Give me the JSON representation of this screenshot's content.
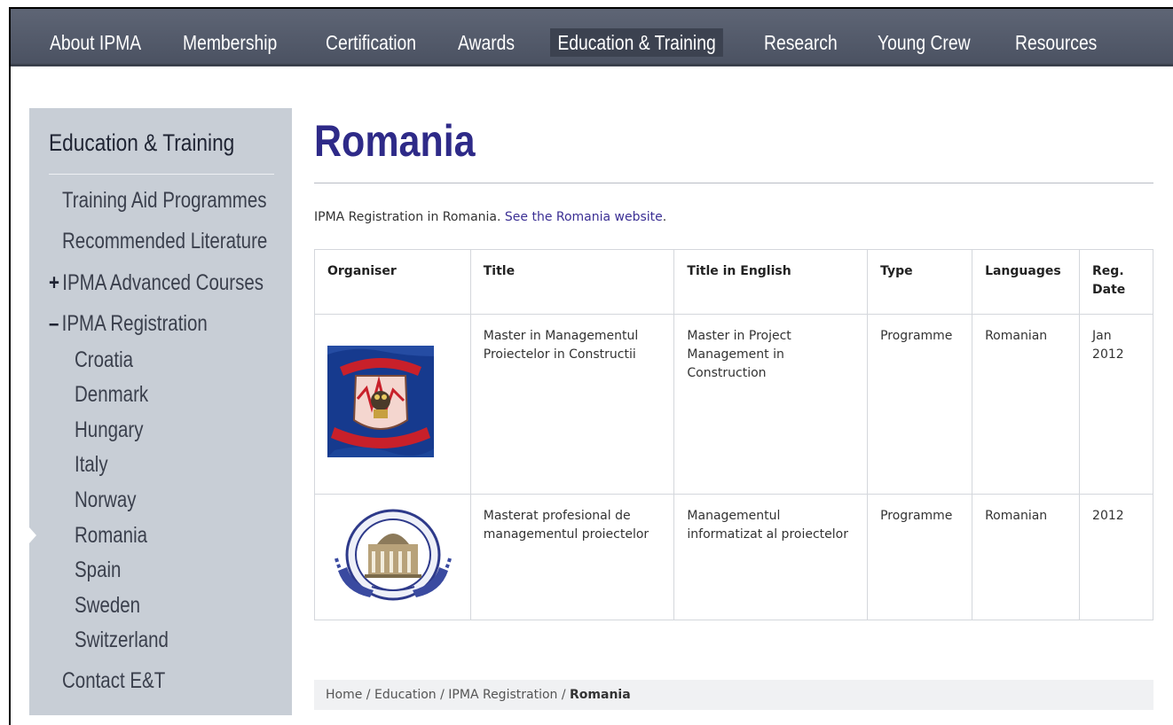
{
  "topnav": {
    "items": [
      "About IPMA",
      "Membership",
      "Certification",
      "Awards",
      "Education & Training",
      "Research",
      "Young Crew",
      "Resources"
    ],
    "active": "Education & Training"
  },
  "sidebar": {
    "title": "Education & Training",
    "items": [
      {
        "label": "Training Aid Programmes",
        "mark": ""
      },
      {
        "label": "Recommended Literature",
        "mark": ""
      },
      {
        "label": "IPMA Advanced Courses",
        "mark": "+"
      },
      {
        "label": "IPMA Registration",
        "mark": "–"
      },
      {
        "label": "Croatia"
      },
      {
        "label": "Denmark"
      },
      {
        "label": "Hungary"
      },
      {
        "label": "Italy"
      },
      {
        "label": "Norway"
      },
      {
        "label": "Romania"
      },
      {
        "label": "Spain"
      },
      {
        "label": "Sweden"
      },
      {
        "label": "Switzerland"
      },
      {
        "label": "Contact E&T",
        "mark": ""
      }
    ]
  },
  "main": {
    "title": "Romania",
    "intro_text": "IPMA Registration in Romania.",
    "intro_link": "See the Romania website",
    "intro_end": "."
  },
  "table": {
    "headers": [
      "Organiser",
      "Title",
      "Title in English",
      "Type",
      "Languages",
      "Reg. Date"
    ],
    "rows": [
      {
        "organiser_logo": "universitatea-tehnica-crest",
        "title": "Master in Managementul Proiectelor in Constructii",
        "title_en": "Master in Project Management in Construction",
        "type": "Programme",
        "languages": "Romanian",
        "reg_date": "Jan 2012"
      },
      {
        "organiser_logo": "academia-studii-economice-seal",
        "title": "Masterat profesional de managementul proiectelor",
        "title_en": "Managementul informatizat al proiectelor",
        "type": "Programme",
        "languages": "Romanian",
        "reg_date": "2012"
      }
    ]
  },
  "breadcrumb": {
    "items": [
      "Home",
      "Education",
      "IPMA Registration"
    ],
    "current": "Romania",
    "separator": "/"
  },
  "colors": {
    "nav_bg": "#4b5262",
    "sidebar_bg": "#c8ced6",
    "title": "#2e2a88",
    "link": "#3b2f94"
  }
}
